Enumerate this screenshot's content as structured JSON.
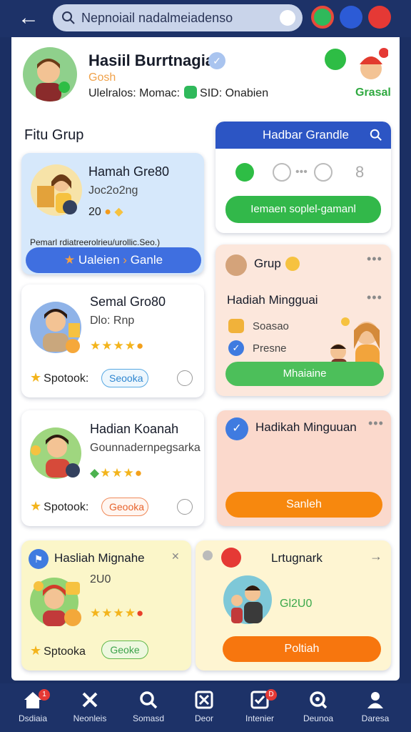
{
  "search": {
    "placeholder": "Nepnoiail nadalmeiadenso"
  },
  "profile": {
    "name": "Hasiil Burrtnagiai",
    "sub": "Gosh",
    "stats_label": "Ulelralos: Momac:",
    "stats_value": "SID: Onabien",
    "badge": "Grasal"
  },
  "section_title": "Fitu Grup",
  "cards": {
    "group1": {
      "title": "Hamah Gre80",
      "sub": "Joc2o2ng",
      "count": "20",
      "desc": "Pemarl rdiatreerolrieu/urollic.Seo.)",
      "button": "Ualeien",
      "button2": "Ganle"
    },
    "leader": {
      "header": "Hadbar Grandle",
      "button": "Iemaen soplel-gamanl"
    },
    "group2": {
      "title": "Semal Gro80",
      "sub": "Dlo: Rnp",
      "spot": "Spotook:",
      "chip": "Seooka"
    },
    "grup": {
      "title": "Grup",
      "subtitle": "Hadiah Mingguai",
      "item1": "Soasao",
      "item2": "Presne",
      "button": "Mhaiaine"
    },
    "group3": {
      "title": "Hadian Koanah",
      "sub": "Gounnadernpegsarka",
      "spot": "Spotook:",
      "chip": "Geooka"
    },
    "weekly": {
      "title": "Hadikah Minguuan",
      "button": "Sanleh"
    },
    "group4": {
      "title": "Hasliah Mignahe",
      "count": "2U0",
      "spot": "Sptooka",
      "chip": "Geoke"
    },
    "last": {
      "title": "Lrtugnark",
      "count": "Gl2U0",
      "button": "Poltiah"
    }
  },
  "nav": [
    {
      "label": "Dsdiaia",
      "badge": "1"
    },
    {
      "label": "Neonleis"
    },
    {
      "label": "Somasd"
    },
    {
      "label": "Deor"
    },
    {
      "label": "Intenier",
      "badge": "D"
    },
    {
      "label": "Deunoa"
    },
    {
      "label": "Daresa"
    }
  ],
  "colors": {
    "primary": "#1d3268",
    "green": "#2fb95b",
    "orange": "#f7880e",
    "blue": "#3a66d8"
  },
  "icons": {
    "back": "back-arrow-icon",
    "search": "search-icon",
    "refresh": "refresh-icon"
  }
}
